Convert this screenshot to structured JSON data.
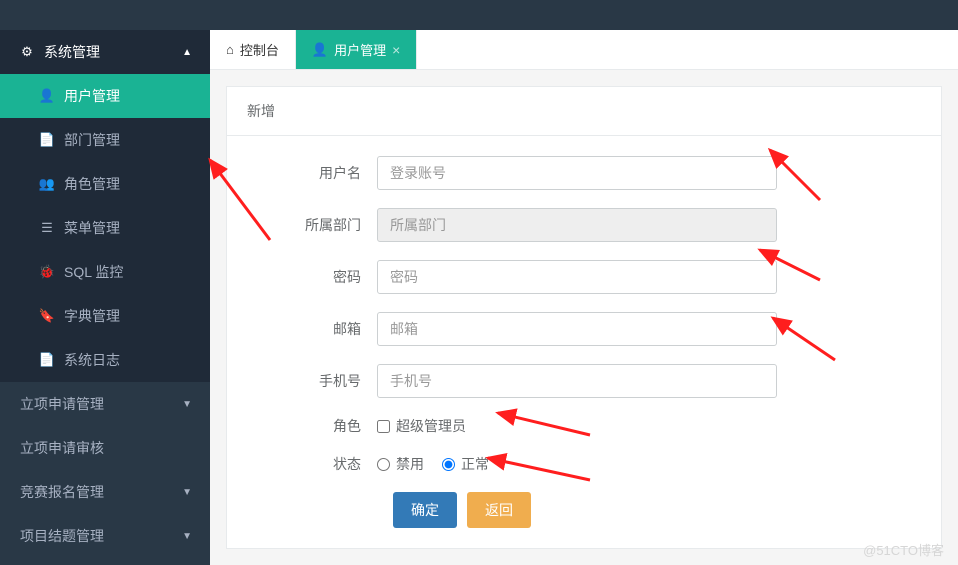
{
  "sidebar": {
    "system": {
      "label": "系统管理",
      "expanded": true,
      "items": [
        {
          "label": "用户管理"
        },
        {
          "label": "部门管理"
        },
        {
          "label": "角色管理"
        },
        {
          "label": "菜单管理"
        },
        {
          "label": "SQL 监控"
        },
        {
          "label": "字典管理"
        },
        {
          "label": "系统日志"
        }
      ]
    },
    "others": [
      {
        "label": "立项申请管理"
      },
      {
        "label": "立项申请审核"
      },
      {
        "label": "竞赛报名管理"
      },
      {
        "label": "项目结题管理"
      }
    ]
  },
  "tabs": {
    "console": "控制台",
    "user_mgmt": "用户管理"
  },
  "panel": {
    "title": "新增"
  },
  "form": {
    "username": {
      "label": "用户名",
      "placeholder": "登录账号"
    },
    "dept": {
      "label": "所属部门",
      "placeholder": "所属部门"
    },
    "password": {
      "label": "密码",
      "placeholder": "密码"
    },
    "email": {
      "label": "邮箱",
      "placeholder": "邮箱"
    },
    "phone": {
      "label": "手机号",
      "placeholder": "手机号"
    },
    "role": {
      "label": "角色",
      "option_super": "超级管理员"
    },
    "status": {
      "label": "状态",
      "option_disabled": "禁用",
      "option_normal": "正常"
    }
  },
  "buttons": {
    "submit": "确定",
    "back": "返回"
  },
  "watermark": "@51CTO博客"
}
